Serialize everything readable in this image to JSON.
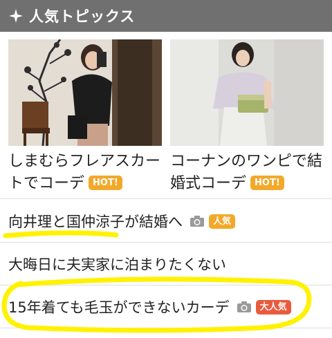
{
  "header": {
    "title": "人気トピックス",
    "star_icon": "sparkle-star-icon",
    "background": "#707070"
  },
  "cards": [
    {
      "title": "しまむらフレアスカートでコーデ",
      "badge": "HOT!",
      "thumbnail": "photo-woman-selfie-black-sweater"
    },
    {
      "title": "コーナンのワンピで結婚式コーデ",
      "badge": "HOT!",
      "thumbnail": "photo-woman-white-dress-clutch"
    }
  ],
  "topics": [
    {
      "text": "向井理と国仲涼子が結婚へ",
      "icon": "camera-icon",
      "badge": "人気",
      "badge_color": "#f2a92a"
    },
    {
      "text": "大晦日に夫実家に泊まりたくない"
    },
    {
      "text": "15年着ても毛玉ができないカーデ",
      "icon": "camera-icon",
      "badge": "大人気",
      "badge_color": "#ea5a3c"
    }
  ],
  "colors": {
    "hot_badge": "#f2a92a",
    "highlighter": "#fff200"
  }
}
